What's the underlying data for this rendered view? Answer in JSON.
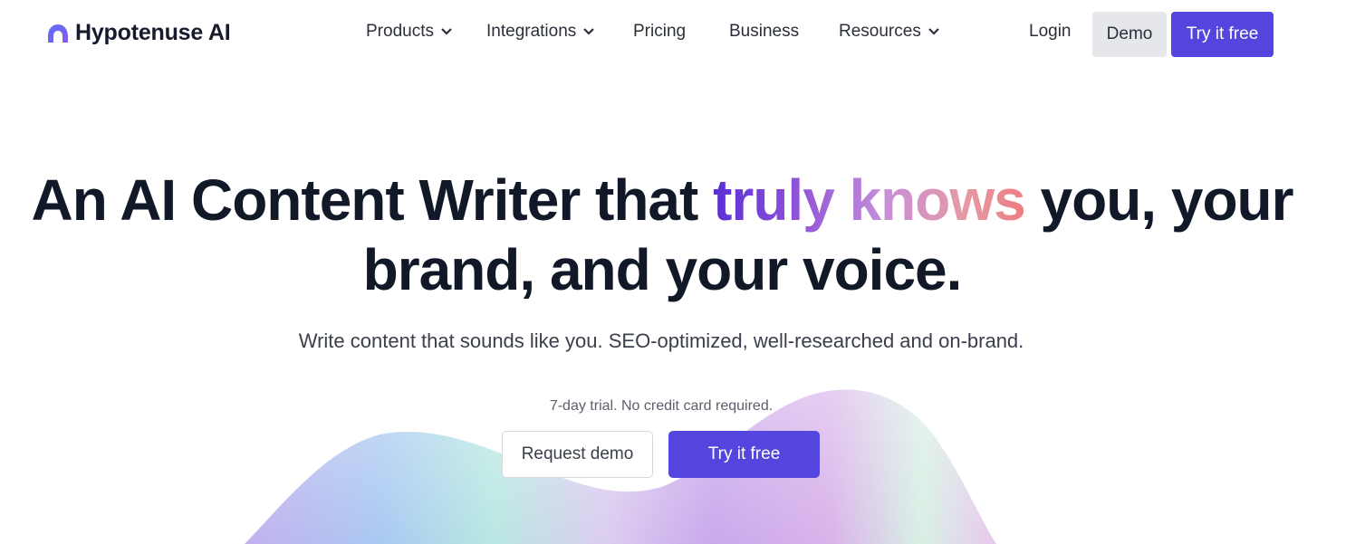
{
  "brand": {
    "name": "Hypotenuse AI",
    "logo_icon": "hypotenuse-logo-icon",
    "logo_color": "#6d5ef0"
  },
  "nav": {
    "items": [
      {
        "label": "Products",
        "has_dropdown": true
      },
      {
        "label": "Integrations",
        "has_dropdown": true
      },
      {
        "label": "Pricing",
        "has_dropdown": false
      },
      {
        "label": "Business",
        "has_dropdown": false
      },
      {
        "label": "Resources",
        "has_dropdown": true
      }
    ],
    "login": "Login",
    "demo": "Demo",
    "try_free": "Try it free"
  },
  "hero": {
    "title_part1": "An AI Content Writer that ",
    "title_highlight": "truly knows",
    "title_part2": " you, your",
    "title_line2": "brand, and your voice.",
    "subtitle": "Write content that sounds like you. SEO-optimized, well-researched and on-brand.",
    "trial_note": "7-day trial. No credit card required.",
    "request_demo": "Request demo",
    "try_free": "Try it free"
  },
  "colors": {
    "accent": "#5445de",
    "heading": "#111827",
    "secondary_button": "#e5e7eb"
  }
}
